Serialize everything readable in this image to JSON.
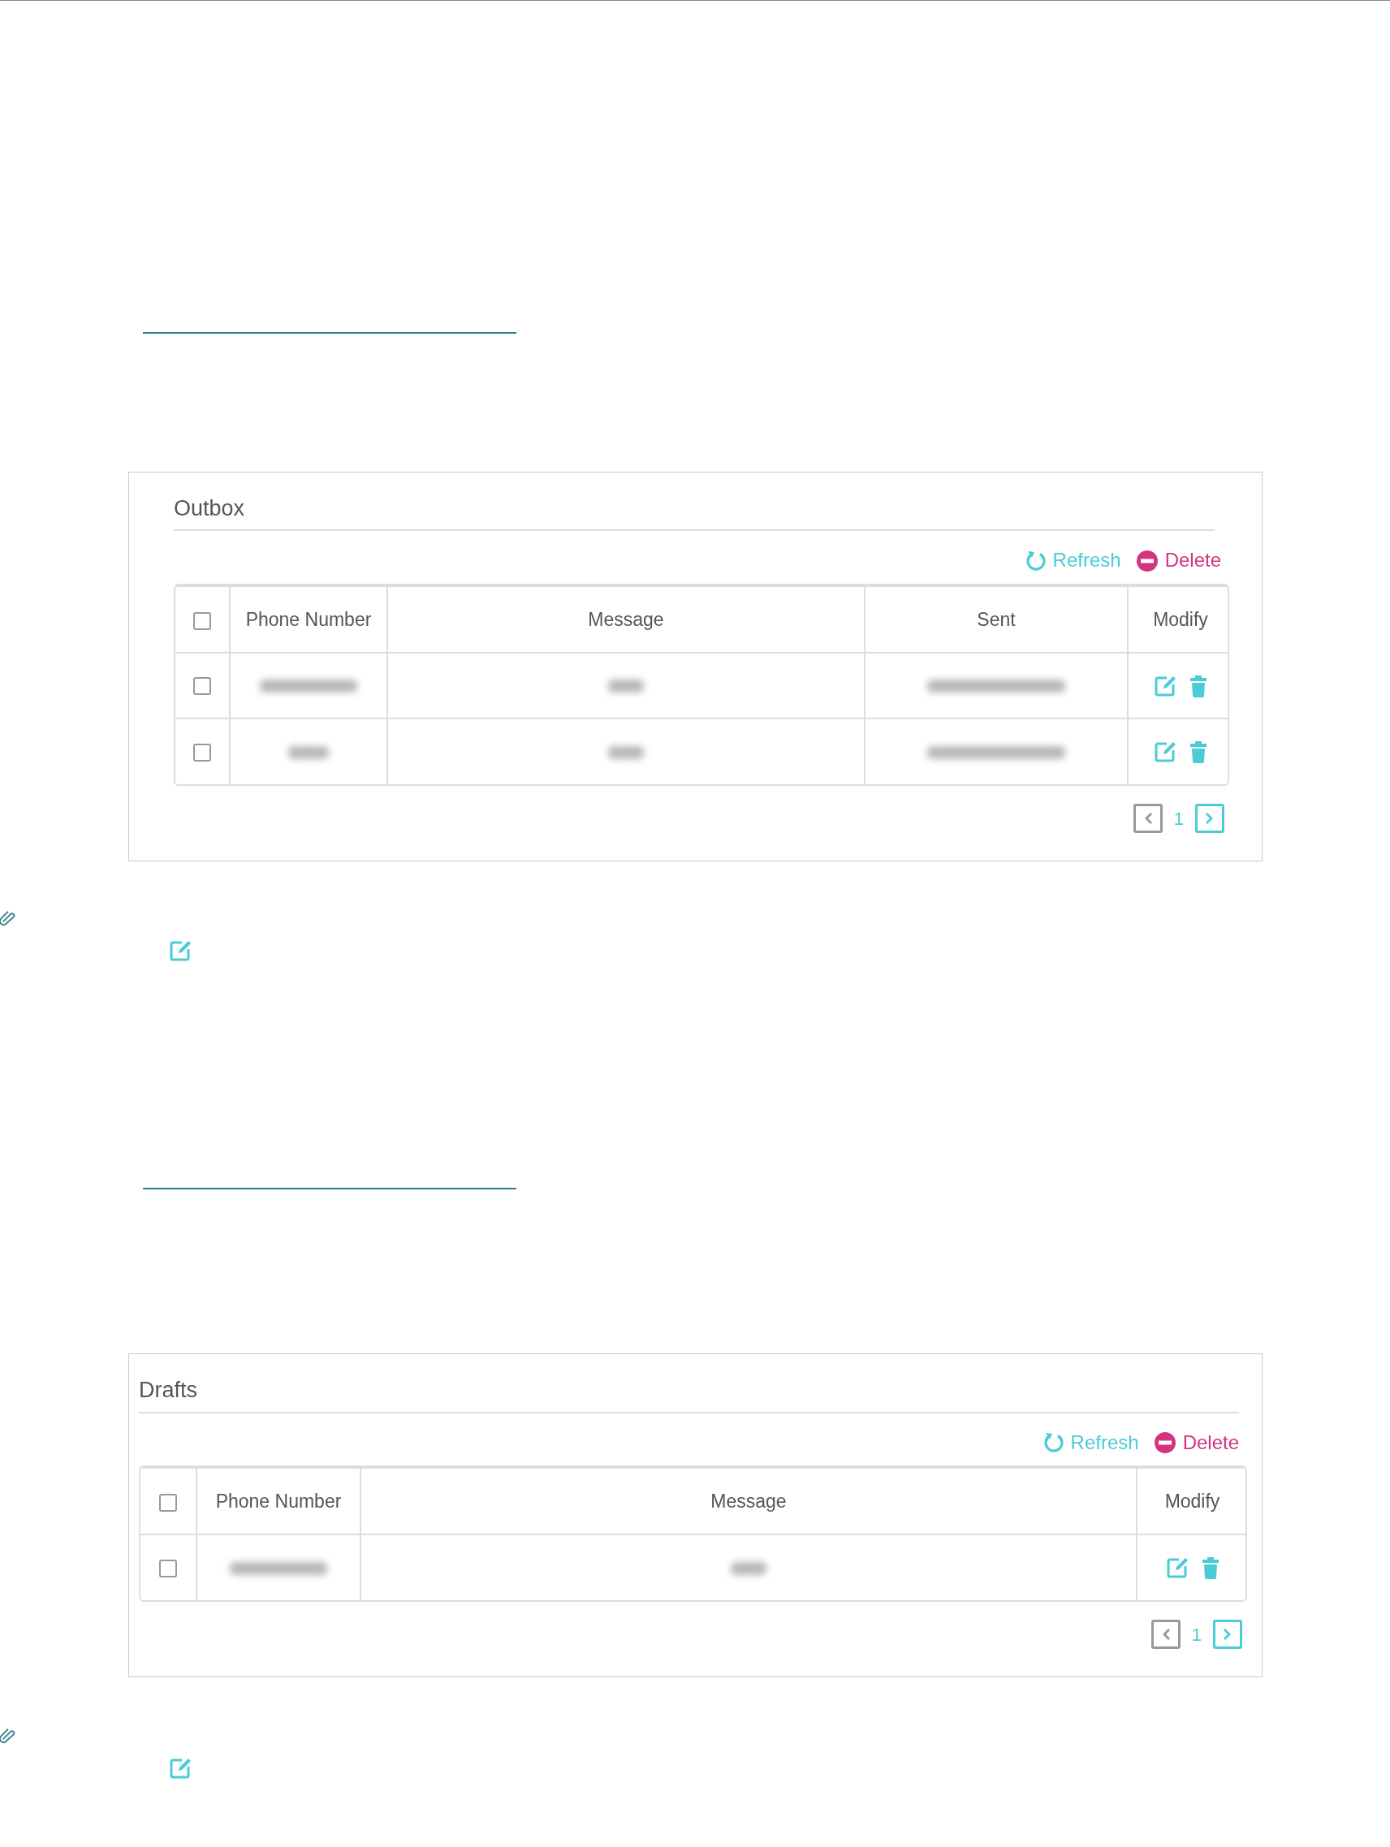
{
  "panels": [
    {
      "kind": "outbox",
      "title": "Outbox",
      "refresh": "Refresh",
      "delete": "Delete",
      "select_all_checked": false,
      "columns": [
        "Phone Number",
        "Message",
        "Sent",
        "Modify"
      ],
      "rows": [
        {
          "checked": false
        },
        {
          "checked": false
        }
      ],
      "pagination": {
        "page": "1",
        "prev_enabled": false,
        "next_enabled": true
      }
    },
    {
      "kind": "drafts",
      "title": "Drafts",
      "refresh": "Refresh",
      "delete": "Delete",
      "select_all_checked": false,
      "columns": [
        "Phone Number",
        "Message",
        "Modify"
      ],
      "rows": [
        {
          "checked": false
        }
      ],
      "pagination": {
        "page": "1",
        "prev_enabled": false,
        "next_enabled": true
      }
    }
  ]
}
